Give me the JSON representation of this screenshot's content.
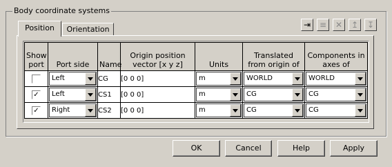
{
  "group": {
    "title": "Body coordinate systems"
  },
  "tabs": [
    {
      "label": "Position",
      "active": true
    },
    {
      "label": "Orientation",
      "active": false
    }
  ],
  "toolbar": {
    "icons": [
      "insert-row-icon",
      "delete-row-icon",
      "close-icon",
      "move-up-icon",
      "move-down-icon"
    ],
    "glyphs": [
      "⇥",
      "≡",
      "✕",
      "↥",
      "↧"
    ]
  },
  "table": {
    "headers": [
      "Show port",
      "Port side",
      "Name",
      "Origin position vector [x y z]",
      "Units",
      "Translated from origin of",
      "Components in axes of"
    ],
    "rows": [
      {
        "show": false,
        "show_glyph": "",
        "port_side": "Left",
        "name": "CG",
        "origin": "[0 0 0]",
        "units": "m",
        "translated": "WORLD",
        "components": "WORLD"
      },
      {
        "show": true,
        "show_glyph": "✓",
        "port_side": "Left",
        "name": "CS1",
        "origin": "[0 0 0]",
        "units": "m",
        "translated": "CG",
        "components": "CG"
      },
      {
        "show": true,
        "show_glyph": "✓",
        "port_side": "Right",
        "name": "CS2",
        "origin": "[0 0 0]",
        "units": "m",
        "translated": "CG",
        "components": "CG"
      }
    ]
  },
  "buttons": {
    "ok": "OK",
    "cancel": "Cancel",
    "help": "Help",
    "apply": "Apply"
  }
}
